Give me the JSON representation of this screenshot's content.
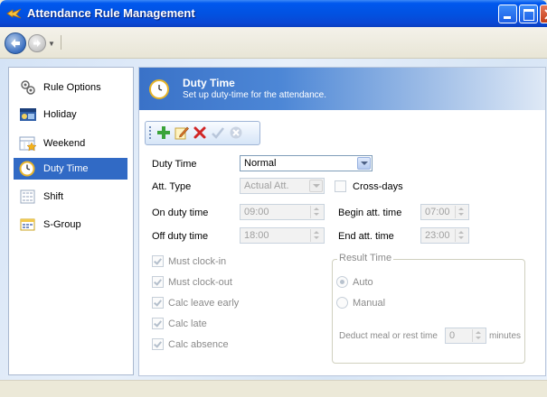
{
  "window": {
    "title": "Attendance Rule Management"
  },
  "sidebar": {
    "items": [
      {
        "label": "Rule Options",
        "icon": "gears-icon",
        "selected": false
      },
      {
        "label": "Holiday",
        "icon": "holiday-icon",
        "selected": false
      },
      {
        "label": "Weekend",
        "icon": "weekend-icon",
        "selected": false
      },
      {
        "label": "Duty Time",
        "icon": "clock-icon",
        "selected": true
      },
      {
        "label": "Shift",
        "icon": "shift-grid-icon",
        "selected": false
      },
      {
        "label": "S-Group",
        "icon": "group-grid-icon",
        "selected": false
      }
    ]
  },
  "header": {
    "title": "Duty Time",
    "subtitle": "Set up duty-time for the attendance."
  },
  "toolbar": {
    "buttons": [
      "add-icon",
      "edit-icon",
      "delete-icon",
      "confirm-icon",
      "cancel-icon"
    ]
  },
  "form": {
    "duty_time": {
      "label": "Duty Time",
      "value": "Normal"
    },
    "att_type": {
      "label": "Att. Type",
      "value": "Actual Att."
    },
    "cross_days": {
      "label": "Cross-days",
      "checked": false
    },
    "on_duty": {
      "label": "On duty time",
      "value": "09:00"
    },
    "begin_att": {
      "label": "Begin att. time",
      "value": "07:00"
    },
    "off_duty": {
      "label": "Off duty time",
      "value": "18:00"
    },
    "end_att": {
      "label": "End att. time",
      "value": "23:00"
    },
    "checks": [
      {
        "label": "Must clock-in",
        "checked": true
      },
      {
        "label": "Must clock-out",
        "checked": true
      },
      {
        "label": "Calc leave early",
        "checked": true
      },
      {
        "label": "Calc late",
        "checked": true
      },
      {
        "label": "Calc absence",
        "checked": true
      }
    ],
    "result_time": {
      "title": "Result Time",
      "auto_label": "Auto",
      "manual_label": "Manual",
      "selected": "Auto",
      "deduct_label": "Deduct meal or rest time",
      "deduct_value": "0",
      "unit": "minutes"
    }
  },
  "colors": {
    "selection": "#316ac5",
    "title_bar": "#0058ee",
    "header_gradient_start": "#3a72c8"
  }
}
